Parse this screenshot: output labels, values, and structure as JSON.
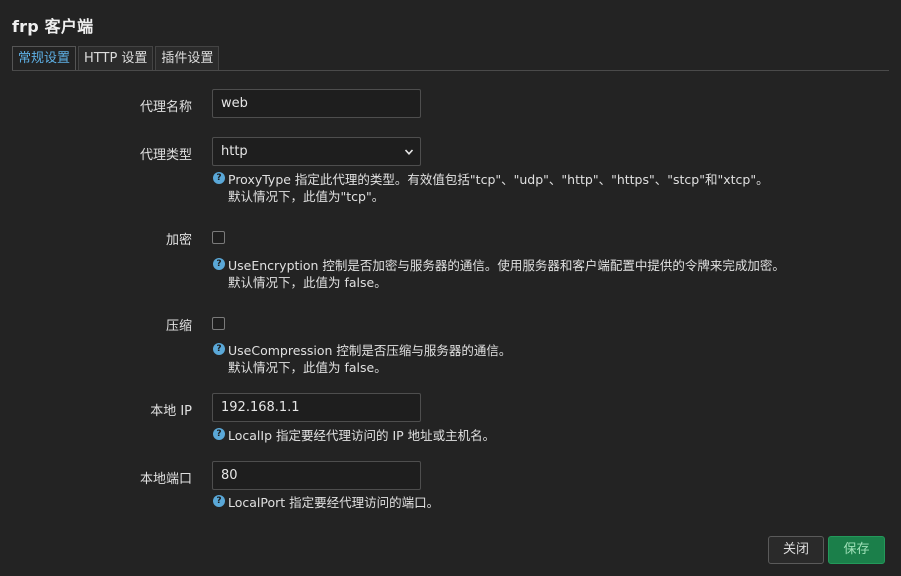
{
  "title": "frp 客户端",
  "tabs": [
    {
      "label": "常规设置",
      "active": true
    },
    {
      "label": "HTTP 设置",
      "active": false
    },
    {
      "label": "插件设置",
      "active": false
    }
  ],
  "form": {
    "proxy_name": {
      "label": "代理名称",
      "value": "web"
    },
    "proxy_type": {
      "label": "代理类型",
      "value": "http",
      "help_line1": "ProxyType 指定此代理的类型。有效值包括\"tcp\"、\"udp\"、\"http\"、\"https\"、\"stcp\"和\"xtcp\"。",
      "help_line2": "默认情况下，此值为\"tcp\"。"
    },
    "encryption": {
      "label": "加密",
      "checked": false,
      "help_line1": "UseEncryption 控制是否加密与服务器的通信。使用服务器和客户端配置中提供的令牌来完成加密。",
      "help_line2": "默认情况下，此值为 false。"
    },
    "compression": {
      "label": "压缩",
      "checked": false,
      "help_line1": "UseCompression 控制是否压缩与服务器的通信。",
      "help_line2": "默认情况下，此值为 false。"
    },
    "local_ip": {
      "label": "本地 IP",
      "value": "192.168.1.1",
      "help_line1": "LocalIp 指定要经代理访问的 IP 地址或主机名。"
    },
    "local_port": {
      "label": "本地端口",
      "value": "80",
      "help_line1": "LocalPort 指定要经代理访问的端口。"
    }
  },
  "buttons": {
    "close_label": "关闭",
    "save_label": "保存"
  },
  "help_icon_glyph": "?",
  "colors": {
    "accent": "#5eb0e5",
    "save": "#1b7f4a",
    "background": "#232323"
  }
}
